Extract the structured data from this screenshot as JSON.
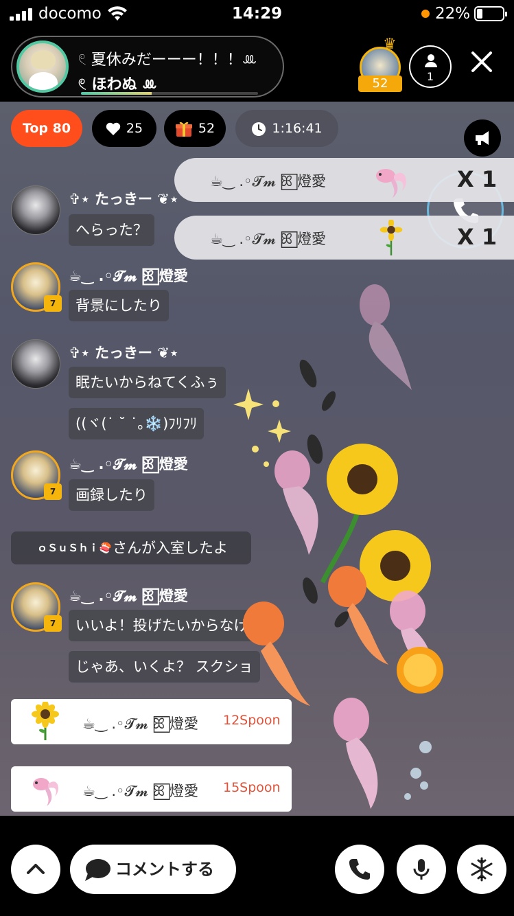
{
  "status_bar": {
    "carrier": "docomo",
    "time": "14:29",
    "battery_percent": "22%"
  },
  "header": {
    "room_title": "𓏲 夏休みだーーー！！！ꔛ",
    "host_name": "𓏲 ほわぬ ꔛ",
    "top_fan_badge": "52",
    "listener_count": "1",
    "progress": 0.4
  },
  "stats": {
    "top_label": "Top",
    "top_rank": "80",
    "likes": "25",
    "gifts": "52",
    "elapsed": "1:16:41"
  },
  "gift_notices": [
    {
      "user": "☕︎︎‿ .◦𝓣𝓶 ꕤ⃞ 燈愛",
      "sticker": "goldfish",
      "count": "X 1"
    },
    {
      "user": "☕︎︎‿ .◦𝓣𝓶 ꕤ⃞ 燈愛",
      "sticker": "sunflower",
      "count": "X 1"
    }
  ],
  "chat": {
    "messages": [
      {
        "user": "✞⋆ たっきー ❦⋆",
        "lines": [
          "へらった？"
        ]
      },
      {
        "user": "☕︎︎‿ .◦𝓣𝓶 ꕤ⃞ 燈愛",
        "badge": "7",
        "lines": [
          "背景にしたり"
        ]
      },
      {
        "user": "✞⋆ たっきー ❦⋆",
        "lines": [
          "眠たいからねてくふぅ",
          "((ヾ(˙ ˘ ˙｡❄️)ﾌﾘﾌﾘ"
        ]
      },
      {
        "user": "☕︎︎‿ .◦𝓣𝓶 ꕤ⃞ 燈愛",
        "badge": "7",
        "lines": [
          "画録したり"
        ]
      },
      {
        "user": "☕︎︎‿ .◦𝓣𝓶 ꕤ⃞ 燈愛",
        "badge": "7",
        "lines": [
          "いいよ！投げたいからなげ",
          "じゃあ、いくよ？ スクショ"
        ]
      }
    ],
    "join_notice": {
      "user": "ｏＳｕＳｈｉ🍣",
      "text": "さんが入室したよ"
    },
    "gift_cards": [
      {
        "sticker": "sunflower",
        "user": "☕︎︎‿ .◦𝓣𝓶 ꕤ⃞ 燈愛",
        "spoon": "12Spoon"
      },
      {
        "sticker": "goldfish",
        "user": "☕︎︎‿ .◦𝓣𝓶 ꕤ⃞ 燈愛",
        "spoon": "15Spoon"
      }
    ]
  },
  "bottom_bar": {
    "comment_label": "コメントする",
    "icons": [
      "chevron-up-icon",
      "phone-icon",
      "microphone-icon",
      "snowflake-icon"
    ]
  },
  "colors": {
    "accent": "#ff4e1c",
    "host_ring": "#52c9a3",
    "fan_gold": "#f5b50a",
    "spoon_red": "#e0533a"
  }
}
